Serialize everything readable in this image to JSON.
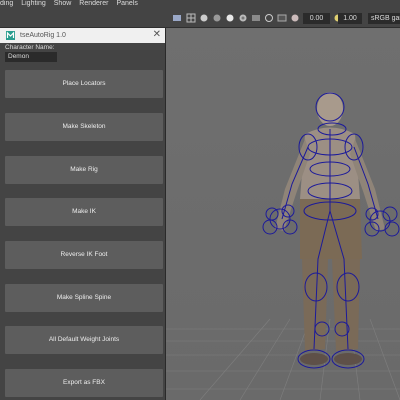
{
  "menubar": {
    "items": [
      "ding",
      "Lighting",
      "Show",
      "Renderer",
      "Panels"
    ]
  },
  "toolbar": {
    "exposure_value": "0.00",
    "gamma_value": "1.00",
    "color_space": "sRGB gam"
  },
  "panel": {
    "title": "tseAutoRig 1.0",
    "close_symbol": "✕",
    "character_name_label": "Character Name:",
    "character_name_value": "Demon",
    "buttons": [
      "Place Locators",
      "Make Skeleton",
      "Make Rig",
      "Make IK",
      "Reverse IK Foot",
      "Make Spline Spine",
      "All Default Weight Joints",
      "Export as FBX"
    ]
  },
  "colors": {
    "panel_bg": "#444444",
    "button_bg": "#5d5d5d",
    "viewport_bg": "#6e6e6e",
    "rig_curves": "#1c1a9a",
    "maya_logo": "#2a9d8f"
  }
}
